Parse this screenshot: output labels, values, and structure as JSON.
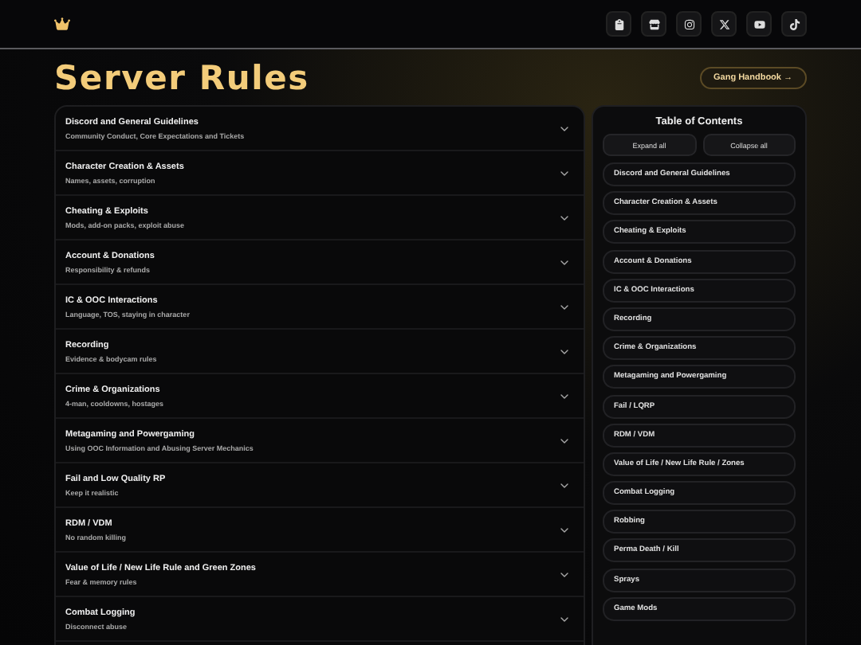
{
  "page": {
    "title": "Server Rules",
    "handbook_button": "Gang Handbook →"
  },
  "rules": [
    {
      "title": "Discord and General Guidelines",
      "subtitle": "Community Conduct, Core Expectations and Tickets",
      "expanded": false
    },
    {
      "title": "Character Creation & Assets",
      "subtitle": "Names, assets, corruption",
      "expanded": false
    },
    {
      "title": "Cheating & Exploits",
      "subtitle": "Mods, add-on packs, exploit abuse",
      "expanded": false
    },
    {
      "title": "Account & Donations",
      "subtitle": "Responsibility & refunds",
      "expanded": false
    },
    {
      "title": "IC & OOC Interactions",
      "subtitle": "Language, TOS, staying in character",
      "expanded": false
    },
    {
      "title": "Recording",
      "subtitle": "Evidence & bodycam rules",
      "expanded": false
    },
    {
      "title": "Crime & Organizations",
      "subtitle": "4-man, cooldowns, hostages",
      "expanded": false
    },
    {
      "title": "Metagaming and Powergaming",
      "subtitle": "Using OOC Information and Abusing Server Mechanics",
      "expanded": false
    },
    {
      "title": "Fail and Low Quality RP",
      "subtitle": "Keep it realistic",
      "expanded": false
    },
    {
      "title": "RDM / VDM",
      "subtitle": "No random killing",
      "expanded": false
    },
    {
      "title": "Value of Life / New Life Rule and Green Zones",
      "subtitle": "Fear & memory rules",
      "expanded": false
    },
    {
      "title": "Combat Logging",
      "subtitle": "Disconnect abuse",
      "expanded": false
    }
  ],
  "toc": {
    "title": "Table of Contents",
    "buttons": [
      "Expand all",
      "Collapse all"
    ],
    "items": [
      "Discord and General Guidelines",
      "Character Creation & Assets",
      "Cheating & Exploits",
      "Account & Donations",
      "IC & OOC Interactions",
      "Recording",
      "Crime & Organizations",
      "Metagaming and Powergaming",
      "Fail / LQRP",
      "RDM / VDM",
      "Value of Life / New Life Rule / Zones",
      "Combat Logging",
      "Robbing",
      "Perma Death / Kill",
      "Sprays",
      "Game Mods"
    ]
  }
}
